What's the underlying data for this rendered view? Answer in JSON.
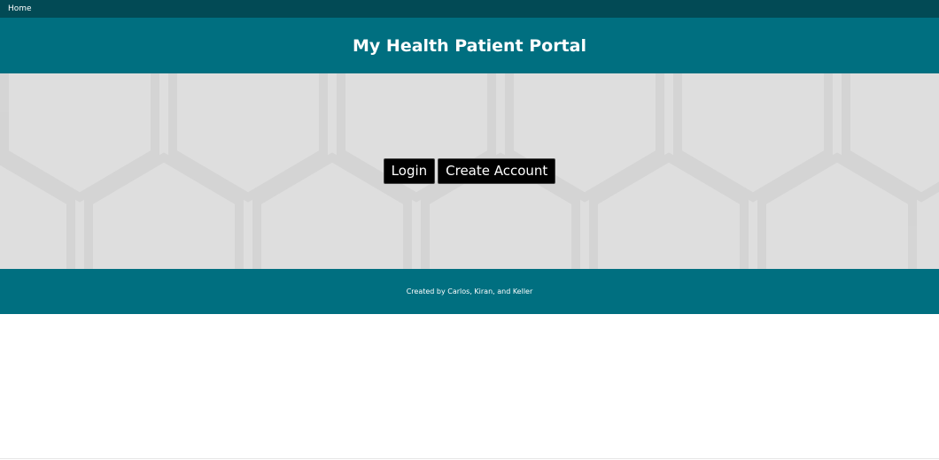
{
  "nav": {
    "home_label": "Home"
  },
  "header": {
    "title": "My Health Patient Portal"
  },
  "hero": {
    "login_label": "Login",
    "create_account_label": "Create Account"
  },
  "footer": {
    "credits": "Created by Carlos, Kiran, and Keller"
  },
  "colors": {
    "nav_bg": "#024a55",
    "brand_teal": "#006f80",
    "hero_bg": "#dedede",
    "button_bg": "#000000",
    "text_light": "#ffffff"
  }
}
